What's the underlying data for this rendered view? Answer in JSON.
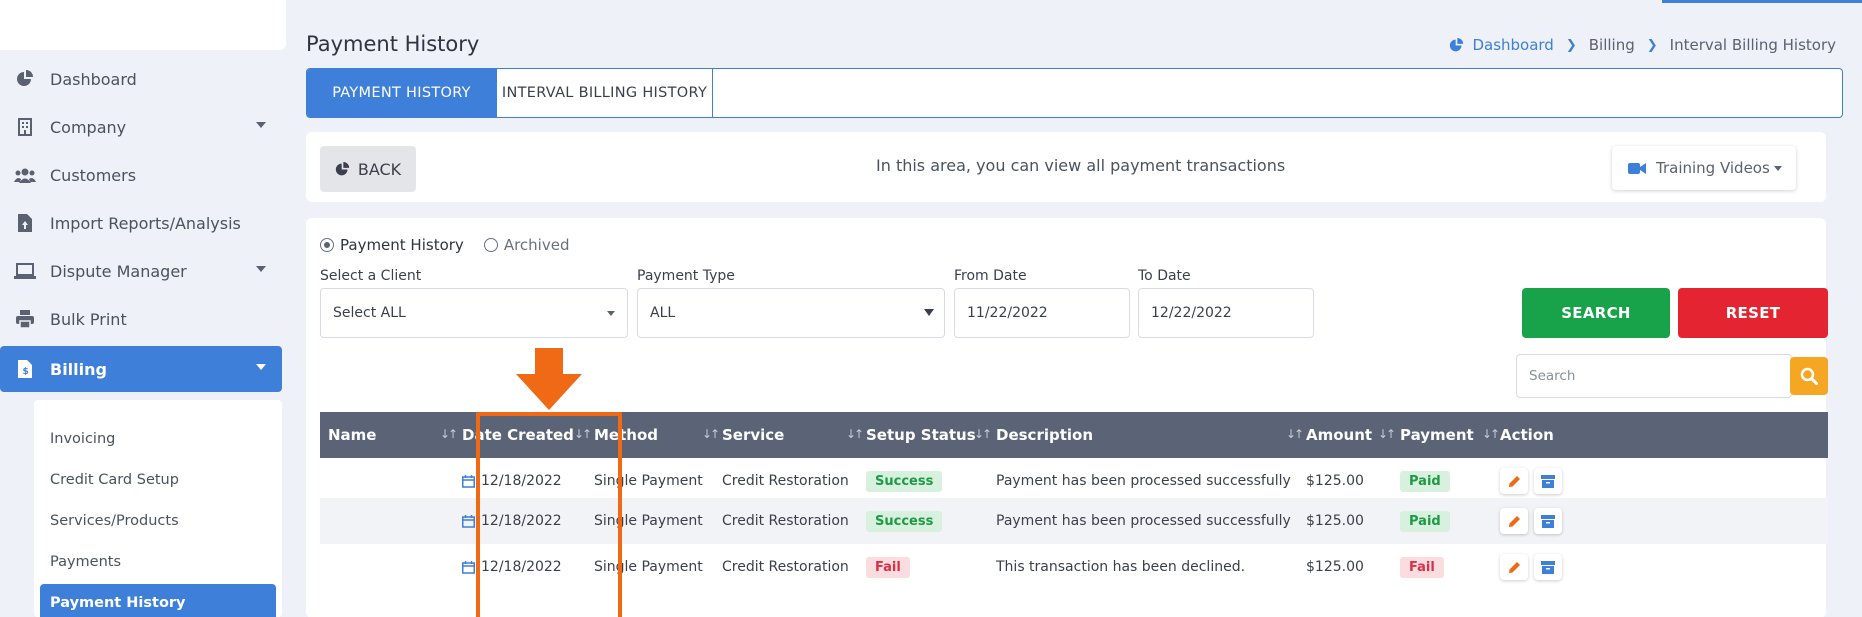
{
  "sidebar": {
    "items": [
      {
        "label": "Dashboard",
        "icon": "pie-chart-icon"
      },
      {
        "label": "Company",
        "icon": "building-icon",
        "has_caret": true
      },
      {
        "label": "Customers",
        "icon": "users-icon"
      },
      {
        "label": "Import Reports/Analysis",
        "icon": "file-upload-icon"
      },
      {
        "label": "Dispute Manager",
        "icon": "laptop-icon",
        "has_caret": true
      },
      {
        "label": "Bulk Print",
        "icon": "printer-icon"
      },
      {
        "label": "Billing",
        "icon": "invoice-icon",
        "has_caret": true,
        "active": true
      }
    ],
    "submenu": [
      {
        "label": "Invoicing"
      },
      {
        "label": "Credit Card Setup"
      },
      {
        "label": "Services/Products"
      },
      {
        "label": "Payments"
      },
      {
        "label": "Payment History",
        "active": true
      }
    ]
  },
  "header": {
    "title": "Payment History",
    "breadcrumb": {
      "home": "Dashboard",
      "items": [
        "Billing",
        "Interval Billing History"
      ]
    }
  },
  "tabs": [
    {
      "label": "PAYMENT HISTORY",
      "active": true
    },
    {
      "label": "INTERVAL BILLING HISTORY",
      "active": false
    }
  ],
  "infobar": {
    "back_label": "BACK",
    "text": "In this area, you can view all payment transactions",
    "training_label": "Training Videos"
  },
  "filters": {
    "radio": [
      {
        "label": "Payment History",
        "checked": true
      },
      {
        "label": "Archived",
        "checked": false
      }
    ],
    "client": {
      "label": "Select a Client",
      "value": "Select ALL"
    },
    "payment_type": {
      "label": "Payment Type",
      "value": "ALL"
    },
    "from_date": {
      "label": "From Date",
      "value": "11/22/2022"
    },
    "to_date": {
      "label": "To Date",
      "value": "12/22/2022"
    },
    "search_button": "SEARCH",
    "reset_button": "RESET",
    "search_placeholder": "Search"
  },
  "table": {
    "columns": [
      "Name",
      "Date Created",
      "Method",
      "Service",
      "Setup Status",
      "Description",
      "Amount",
      "Payment",
      "Action"
    ],
    "rows": [
      {
        "name": "",
        "date": "12/18/2022",
        "method": "Single Payment",
        "service": "Credit Restoration",
        "setup_status": "Success",
        "description": "Payment has been processed successfully",
        "amount": "$125.00",
        "payment": "Paid"
      },
      {
        "name": "",
        "date": "12/18/2022",
        "method": "Single Payment",
        "service": "Credit Restoration",
        "setup_status": "Success",
        "description": "Payment has been processed successfully",
        "amount": "$125.00",
        "payment": "Paid"
      },
      {
        "name": "",
        "date": "12/18/2022",
        "method": "Single Payment",
        "service": "Credit Restoration",
        "setup_status": "Fail",
        "description": "This transaction has been declined.",
        "amount": "$125.00",
        "payment": "Fail"
      }
    ]
  },
  "colors": {
    "accent": "#3d7fd9",
    "success": "#18a34a",
    "danger": "#e42531",
    "warning": "#f5a623",
    "annotation": "#f06a16",
    "table_header": "#5b6477"
  }
}
